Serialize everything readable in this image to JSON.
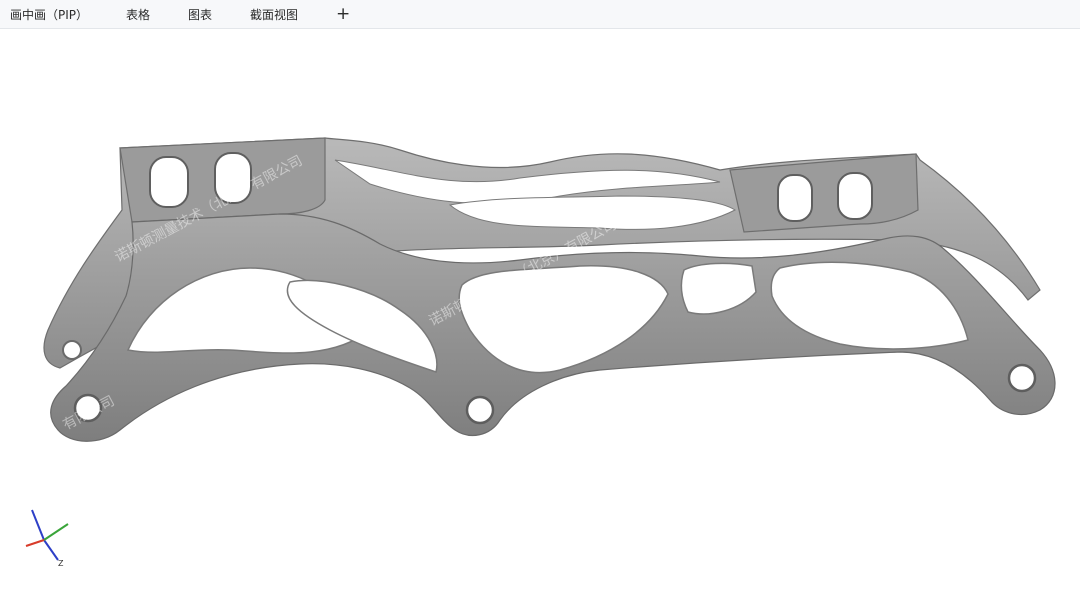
{
  "tabs": [
    {
      "label": "画中画（PIP）"
    },
    {
      "label": "表格"
    },
    {
      "label": "图表"
    },
    {
      "label": "截面视图"
    }
  ],
  "add_tab_label": "+",
  "viewport": {
    "model": "inline skate frame (3D scan)",
    "watermark": "诺斯顿测量技术（北京）有限公司",
    "watermark_short": "有限公司",
    "triad": {
      "z_label": "Z"
    }
  },
  "colors": {
    "background": "#ffffff",
    "part_fill": "#9d9d9d",
    "part_edge": "#6e6e6e",
    "x_axis": "#d83b2a",
    "y_axis": "#3aa53a",
    "z_axis": "#2d3fc7"
  }
}
